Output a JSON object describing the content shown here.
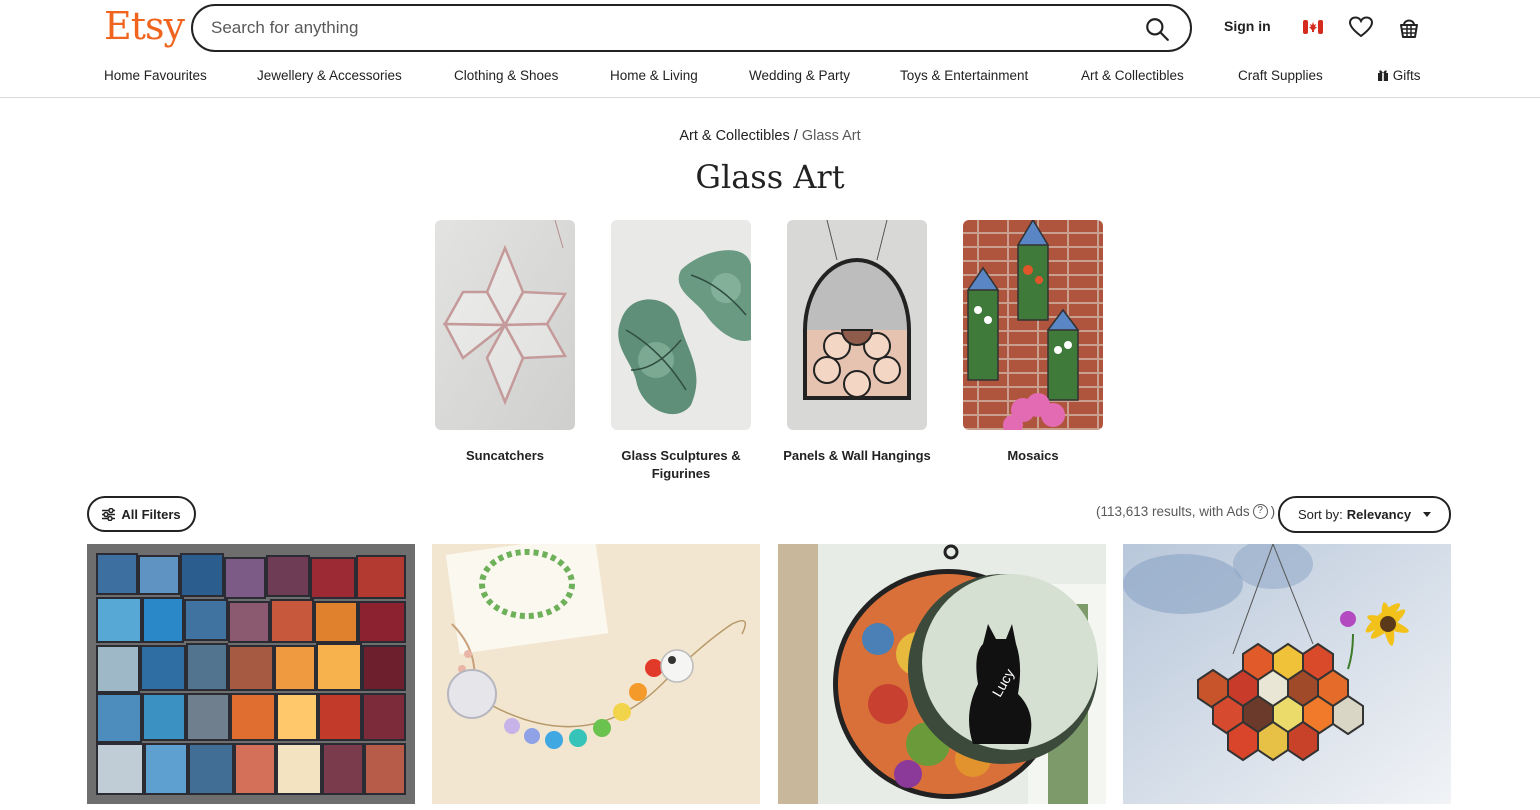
{
  "header": {
    "logo": "Etsy",
    "search_placeholder": "Search for anything",
    "sign_in": "Sign in"
  },
  "nav": [
    "Home Favourites",
    "Jewellery & Accessories",
    "Clothing & Shoes",
    "Home & Living",
    "Wedding & Party",
    "Toys & Entertainment",
    "Art & Collectibles",
    "Craft Supplies",
    "Gifts"
  ],
  "breadcrumb": {
    "parent": "Art & Collectibles",
    "separator": "/",
    "current": "Glass Art"
  },
  "page_title": "Glass Art",
  "subcategories": [
    {
      "label": "Suncatchers"
    },
    {
      "label": "Glass Sculptures & Figurines"
    },
    {
      "label": "Panels & Wall Hangings"
    },
    {
      "label": "Mosaics"
    }
  ],
  "filters": {
    "all_filters": "All Filters",
    "results": "(113,613 results, with Ads",
    "results_close": ")",
    "help_mark": "?",
    "sort_prefix": "Sort by:",
    "sort_value": "Relevancy"
  },
  "listings": [
    {
      "icon": "stained-glass-mosaic-image"
    },
    {
      "icon": "crystal-suncatcher-image"
    },
    {
      "icon": "cat-moon-suncatcher-image"
    },
    {
      "icon": "honeycomb-suncatcher-image"
    }
  ],
  "colors": {
    "brand": "#f1641e",
    "text": "#222222",
    "muted": "#595959",
    "border": "#d9d9d9"
  }
}
